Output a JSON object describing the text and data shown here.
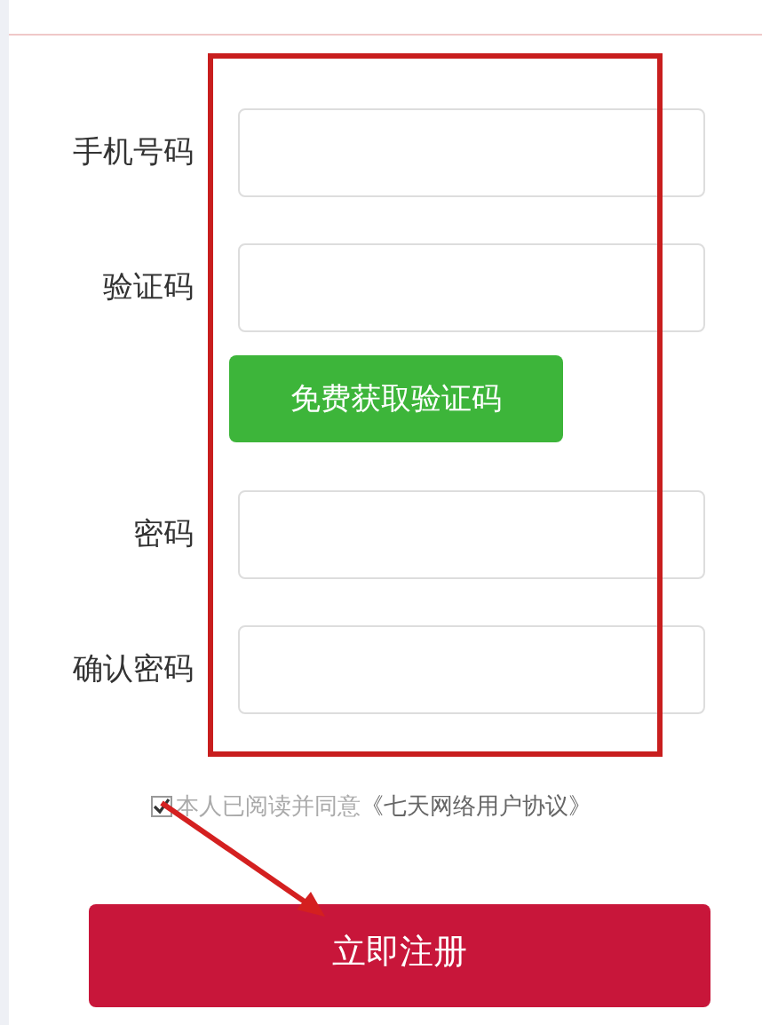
{
  "form": {
    "fields": [
      {
        "label": "手机号码"
      },
      {
        "label": "验证码"
      },
      {
        "label": "密码"
      },
      {
        "label": "确认密码"
      }
    ],
    "code_button": "免费获取验证码",
    "agreement": {
      "checked": true,
      "text": "本人已阅读并同意",
      "link": "《七天网络用户协议》"
    },
    "submit": "立即注册"
  }
}
